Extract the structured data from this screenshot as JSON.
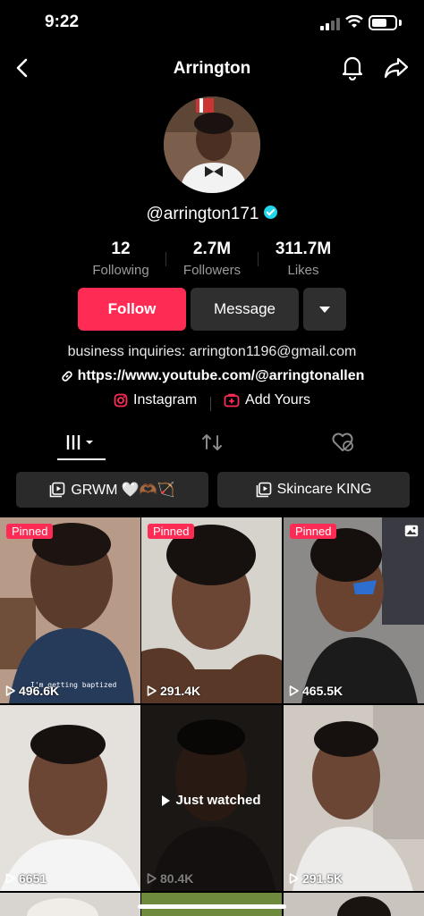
{
  "status_bar": {
    "time": "9:22"
  },
  "nav": {
    "title": "Arrington",
    "back_icon": "chevron-left-icon",
    "bell_icon": "bell-icon",
    "share_icon": "share-arrow-icon"
  },
  "profile": {
    "username": "@arrington171",
    "verified": true,
    "stats": [
      {
        "value": "12",
        "label": "Following"
      },
      {
        "value": "2.7M",
        "label": "Followers"
      },
      {
        "value": "311.7M",
        "label": "Likes"
      }
    ],
    "buttons": {
      "follow": "Follow",
      "message": "Message"
    },
    "bio": "business inquiries: arrington1196@gmail.com",
    "link": "https://www.youtube.com/@arringtonallen",
    "social": {
      "instagram": "Instagram",
      "add_yours": "Add Yours"
    }
  },
  "colors": {
    "accent": "#fe2c55",
    "verified": "#20d5ec",
    "button_dark": "#2f2f2f"
  },
  "playlists": [
    {
      "label": "GRWM 🤍🫶🏾🏹"
    },
    {
      "label": "Skincare KING"
    }
  ],
  "videos": [
    {
      "pinned": "Pinned",
      "views": "496.6K",
      "caption": "I'm getting baptized"
    },
    {
      "pinned": "Pinned",
      "views": "291.4K"
    },
    {
      "pinned": "Pinned",
      "views": "465.5K"
    },
    {
      "views": "6651"
    },
    {
      "views": "80.4K",
      "overlay": "Just watched"
    },
    {
      "views": "291.5K"
    }
  ]
}
